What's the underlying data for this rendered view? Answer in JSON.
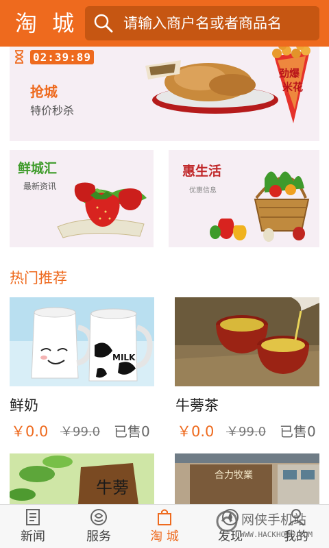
{
  "header": {
    "title": "淘 城",
    "search_placeholder": "请输入商户名或者商品名"
  },
  "flash_sale": {
    "timer": "02:39:89",
    "title": "抢城",
    "subtitle": "特价秒杀",
    "art_labels": [
      "劲爆",
      "米花"
    ]
  },
  "tiles": [
    {
      "title": "鲜城汇",
      "subtitle": "最新资讯"
    },
    {
      "title": "惠生活",
      "subtitle": "优惠信息"
    }
  ],
  "hot": {
    "title": "热门推荐",
    "items": [
      {
        "name": "鲜奶",
        "price": "￥0.0",
        "original_price": "￥99.0",
        "sold": "已售0",
        "art_label": "MILK"
      },
      {
        "name": "牛蒡茶",
        "price": "￥0.0",
        "original_price": "￥99.0",
        "sold": "已售0"
      },
      {
        "art_label": "牛蒡"
      },
      {
        "art_label": "合力牧業"
      }
    ]
  },
  "tabbar": {
    "items": [
      {
        "label": "新闻",
        "icon": "newspaper-icon"
      },
      {
        "label": "服务",
        "icon": "service-icon"
      },
      {
        "label": "淘 城",
        "icon": "shopping-bag-icon",
        "active": true
      },
      {
        "label": "发现",
        "icon": "discover-icon"
      },
      {
        "label": "我的",
        "icon": "profile-icon"
      }
    ]
  },
  "watermark": {
    "text": "网侠手机站",
    "url": "WWW.HACKHOME.COM"
  },
  "colors": {
    "accent": "#ee6a1e",
    "search_bg": "#c65612",
    "green": "#3e9b2a",
    "red": "#c0282a"
  }
}
